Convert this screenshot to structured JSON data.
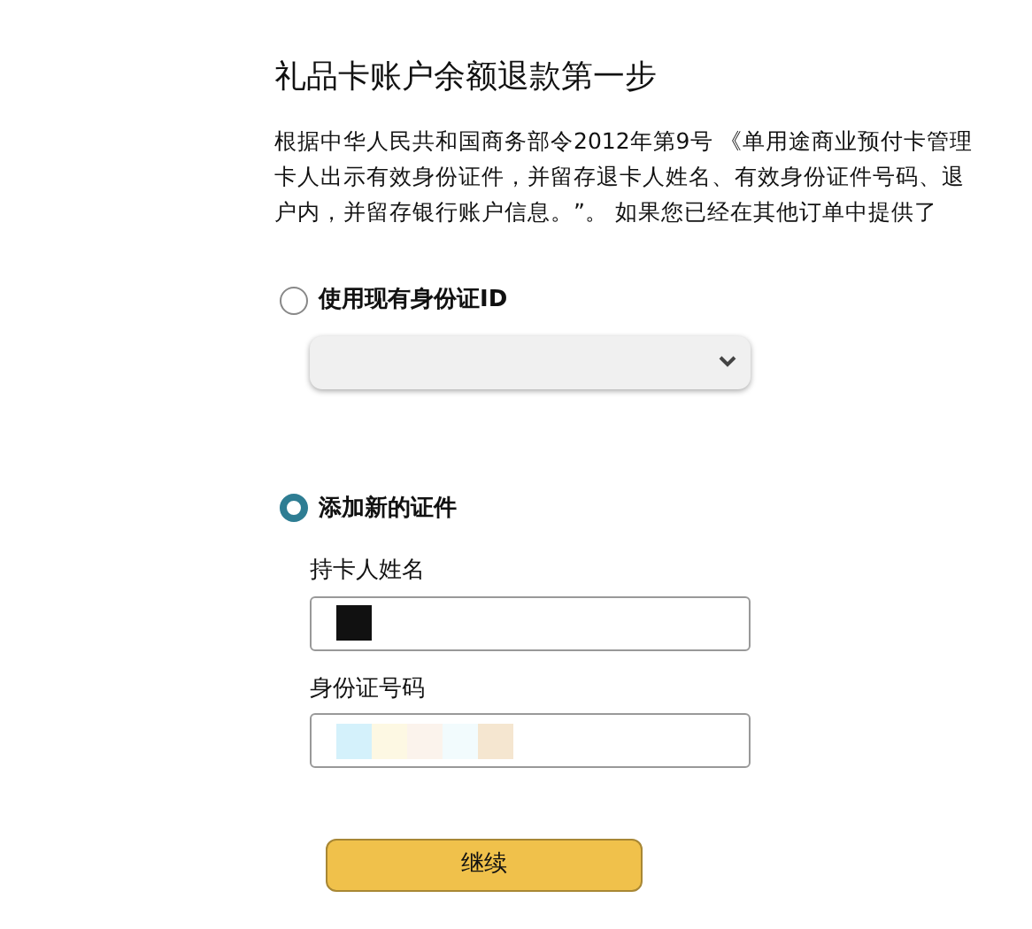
{
  "title": "礼品卡账户余额退款第一步",
  "intro_lines": [
    "根据中华人民共和国商务部令2012年第9号 《单用途商业预付卡管理",
    "卡人出示有效身份证件，并留存退卡人姓名、有效身份证件号码、退",
    "户内，并留存银行账户信息。”。 如果您已经在其他订单中提供了"
  ],
  "options": [
    {
      "label": "使用现有身份证ID",
      "selected": false
    },
    {
      "label": "添加新的证件",
      "selected": true
    }
  ],
  "fields": [
    {
      "label": "持卡人姓名"
    },
    {
      "label": "身份证号码"
    }
  ],
  "button": "继续"
}
